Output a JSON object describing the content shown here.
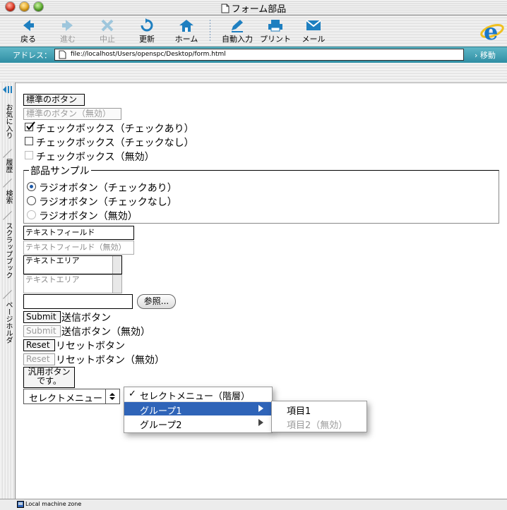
{
  "window": {
    "title": "フォーム部品"
  },
  "toolbar": {
    "back": "戻る",
    "forward": "進む",
    "stop": "中止",
    "refresh": "更新",
    "home": "ホーム",
    "autofill": "自動入力",
    "print": "プリント",
    "mail": "メール"
  },
  "address_bar": {
    "label": "アドレス：",
    "url": "file://localhost/Users/openspc/Desktop/form.html",
    "go": "移動"
  },
  "sidebar": {
    "tabs": [
      "お気に入り",
      "履歴",
      "検索",
      "スクラップブック",
      "ページホルダ"
    ]
  },
  "status": {
    "text": "Local machine zone"
  },
  "form": {
    "std_button": "標準のボタン",
    "std_button_disabled": "標準のボタン（無効）",
    "checkbox_checked": "チェックボックス（チェックあり）",
    "checkbox_unchecked": "チェックボックス（チェックなし）",
    "checkbox_disabled": "チェックボックス（無効）",
    "fieldset_legend": "部品サンプル",
    "radio_checked": "ラジオボタン（チェックあり）",
    "radio_unchecked": "ラジオボタン（チェックなし）",
    "radio_disabled": "ラジオボタン（無効）",
    "textfield_value": "テキストフィールド",
    "textfield_disabled_value": "テキストフィールド（無効）",
    "textarea_value": "テキストエリア",
    "textarea_disabled_value": "テキストエリア",
    "browse_button": "参照...",
    "submit_button": "Submit",
    "submit_text": "送信ボタン",
    "submit_disabled_button": "Submit",
    "submit_disabled_text": "送信ボタン（無効）",
    "reset_button": "Reset",
    "reset_text": "リセットボタン",
    "reset_disabled_button": "Reset",
    "reset_disabled_text": "リセットボタン（無効）",
    "generic_button_line1": "汎用ボタン",
    "generic_button_line2": "です。",
    "select_menu": "セレクトメニュー",
    "select_hier_checked": "✓",
    "select_hier_title": "セレクトメニュー（階層）",
    "group1": "グループ1",
    "group2": "グループ2",
    "item1": "項目1",
    "item2_disabled": "項目2（無効）"
  }
}
